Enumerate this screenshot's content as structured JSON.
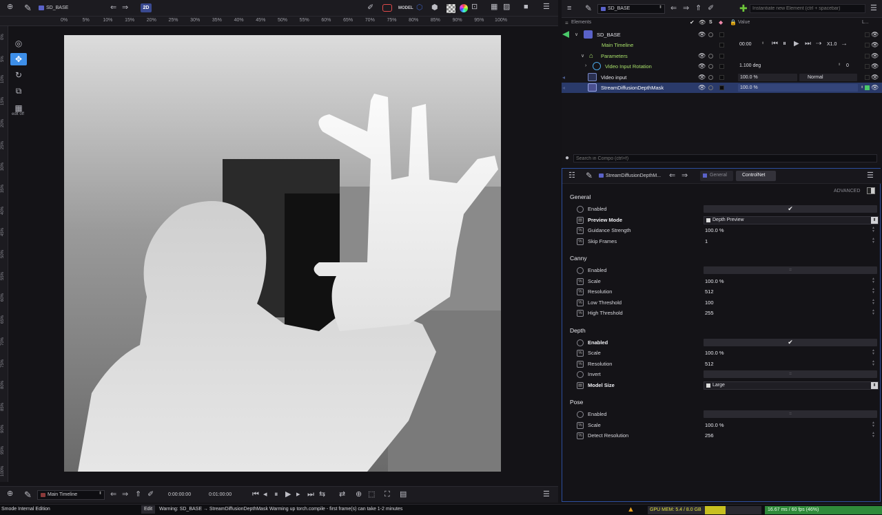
{
  "viewer": {
    "comp_name": "SD_BASE",
    "model_label": "MODEL",
    "mode_2d": "2D",
    "ruler_top": [
      "0%",
      "5%",
      "10%",
      "15%",
      "20%",
      "25%",
      "30%",
      "35%",
      "40%",
      "45%",
      "50%",
      "55%",
      "60%",
      "65%",
      "70%",
      "75%",
      "80%",
      "85%",
      "90%",
      "95%",
      "100%"
    ],
    "ruler_left": [
      "0%",
      "5%",
      "10%",
      "15%",
      "20%",
      "25%",
      "30%",
      "35%",
      "40%",
      "45%",
      "50%",
      "55%",
      "60%",
      "65%",
      "70%",
      "75%",
      "80%",
      "85%",
      "90%",
      "95%",
      "100%"
    ],
    "tools": [
      {
        "name": "select-tool",
        "icon": "cursor-icon"
      },
      {
        "name": "move-tool",
        "icon": "move-icon"
      },
      {
        "name": "rotate-tool",
        "icon": "rotate-icon"
      },
      {
        "name": "edit-tool",
        "icon": "edit-icon"
      },
      {
        "name": "grid-tool",
        "icon": "grid-icon",
        "label": "edit off"
      }
    ]
  },
  "bottom_toolbar": {
    "timeline_name": "Main Timeline",
    "time_current": "0:00:00:00",
    "time_end": "0:01:00:00"
  },
  "status": {
    "edition": "Smode Internal Edition",
    "edit_label": "Edit",
    "warning": "Warning: SD_BASE → StreamDiffusionDepthMask Warming up torch.compile - first frame(s) can take 1-2 minutes",
    "gpu_mem": "GPU MEM: 5.4 / 8.0 GB",
    "fps": "16.67 ms / 60 fps (46%)",
    "accent_warning": "#e8a020",
    "accent_gpu": "#c8c020",
    "accent_fps": "#2f8a3a"
  },
  "outliner": {
    "comp_name": "SD_BASE",
    "instantiate_placeholder": "Instantiate new Element (ctrl + spacebar)",
    "col_elements": "Elements",
    "col_s": "S",
    "col_value": "Value",
    "col_extra": "L...",
    "search_placeholder": "Search in Compo (ctrl+f)",
    "rows": [
      {
        "label": "SD_BASE",
        "value": ""
      },
      {
        "label": "Main Timeline",
        "value": "00:00",
        "speed": "X1.0"
      },
      {
        "label": "Parameters",
        "value": ""
      },
      {
        "label": "Video Input Rotation",
        "value": "1.100 deg",
        "extra": "0"
      },
      {
        "label": "Video input",
        "value": "100.0 %",
        "blend": "Normal"
      },
      {
        "label": "StreamDiffusionDepthMask",
        "value": "100.0 %"
      }
    ]
  },
  "inspector": {
    "title": "StreamDiffusionDepthM...",
    "tab_general": "General",
    "tab_controlnet": "ControlNet",
    "advanced": "ADVANCED",
    "sections": [
      {
        "title": "General",
        "params": [
          {
            "label": "Enabled",
            "type": "check",
            "value": "✔"
          },
          {
            "label": "Preview Mode",
            "type": "select",
            "value": "Depth Preview",
            "bold": true
          },
          {
            "label": "Guidance Strength",
            "type": "num",
            "value": "100.0 %"
          },
          {
            "label": "Skip Frames",
            "type": "num",
            "value": "1"
          }
        ]
      },
      {
        "title": "Canny",
        "params": [
          {
            "label": "Enabled",
            "type": "check",
            "value": "="
          },
          {
            "label": "Scale",
            "type": "num",
            "value": "100.0 %"
          },
          {
            "label": "Resolution",
            "type": "num",
            "value": "512"
          },
          {
            "label": "Low Threshold",
            "type": "num",
            "value": "100"
          },
          {
            "label": "High Threshold",
            "type": "num",
            "value": "255"
          }
        ]
      },
      {
        "title": "Depth",
        "params": [
          {
            "label": "Enabled",
            "type": "check",
            "value": "✔",
            "bold": true
          },
          {
            "label": "Scale",
            "type": "num",
            "value": "100.0 %"
          },
          {
            "label": "Resolution",
            "type": "num",
            "value": "512"
          },
          {
            "label": "Invert",
            "type": "check",
            "value": "="
          },
          {
            "label": "Model Size",
            "type": "select",
            "value": "Large",
            "bold": true
          }
        ]
      },
      {
        "title": "Pose",
        "params": [
          {
            "label": "Enabled",
            "type": "check",
            "value": "="
          },
          {
            "label": "Scale",
            "type": "num",
            "value": "100.0 %"
          },
          {
            "label": "Detect Resolution",
            "type": "num",
            "value": "256"
          }
        ]
      }
    ]
  }
}
